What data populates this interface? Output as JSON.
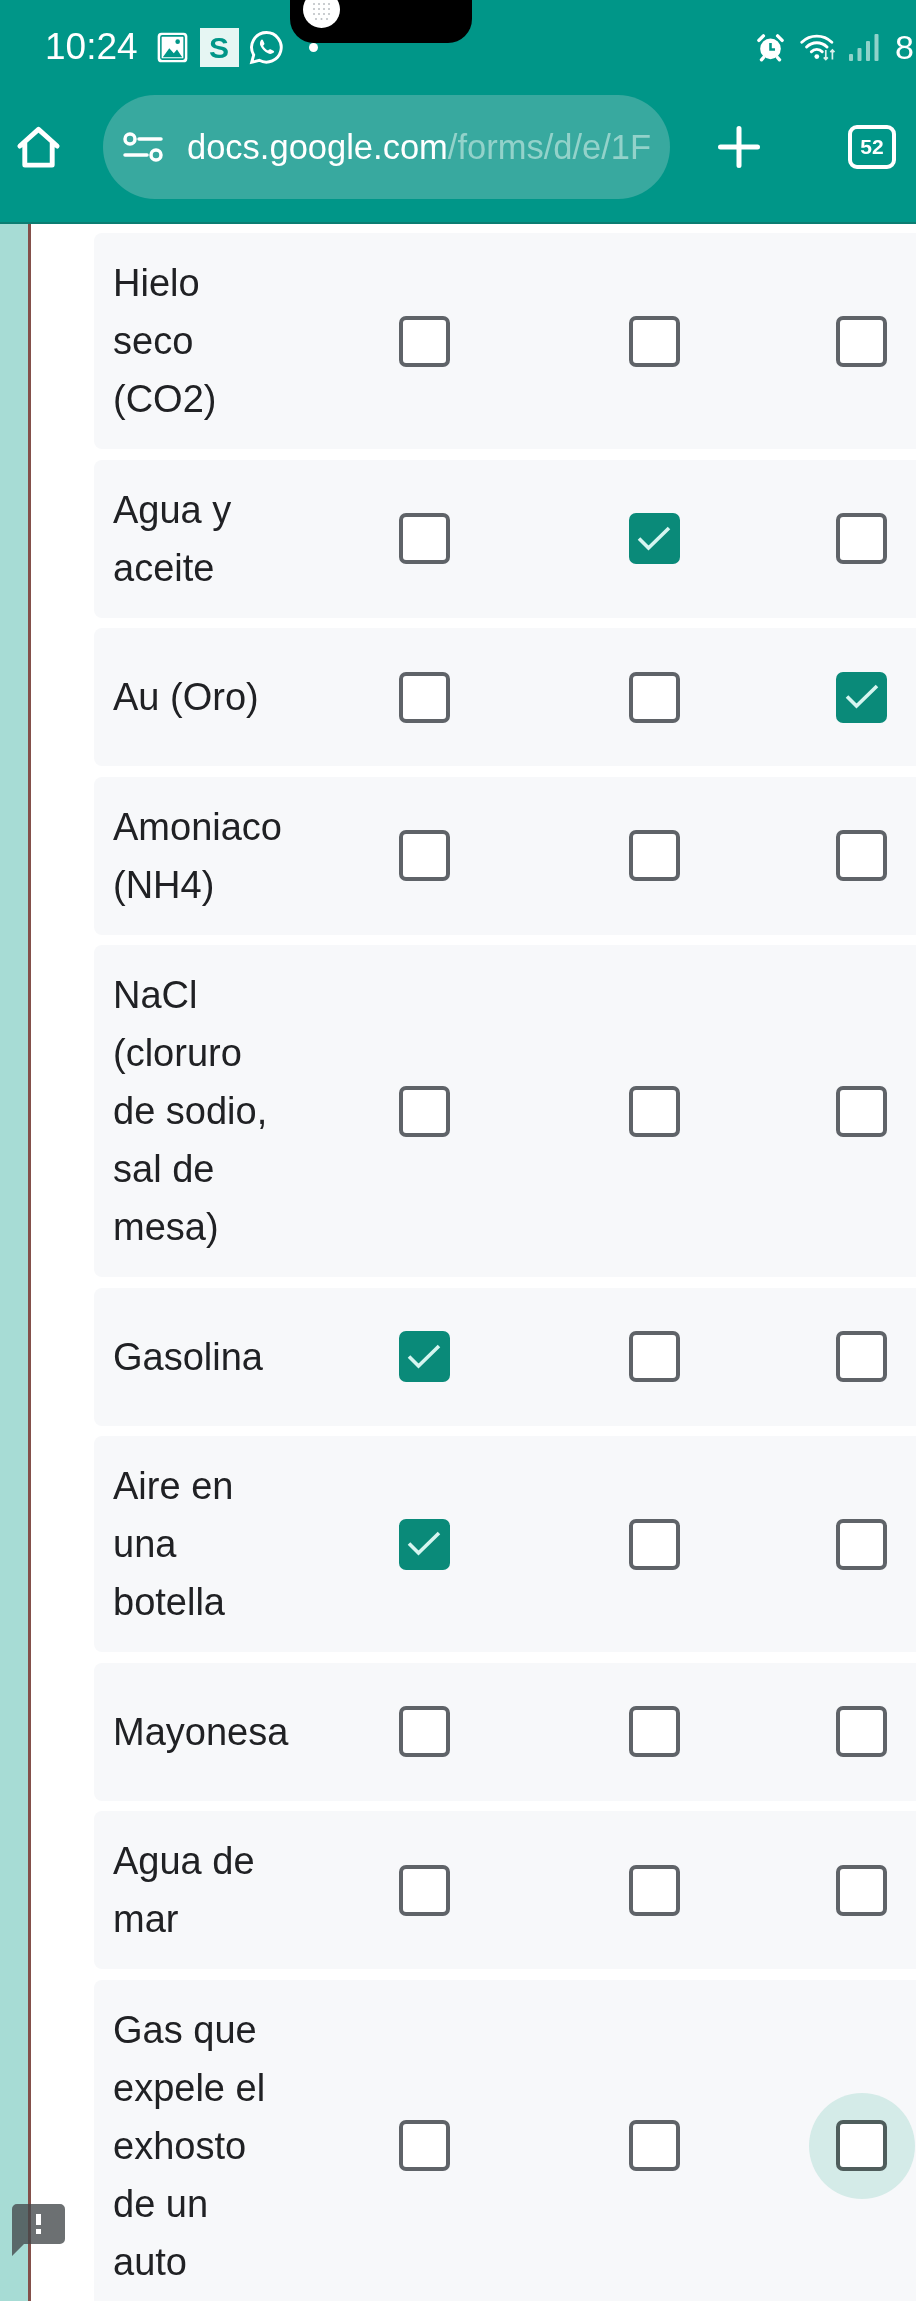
{
  "status_bar": {
    "time": "10:24",
    "app_badge": "S",
    "battery": "8"
  },
  "browser_toolbar": {
    "url_domain": "docs.google.com",
    "url_path": "/forms/d/e/1F",
    "tab_count": "52"
  },
  "grid": {
    "rows": [
      {
        "label": "Hielo seco (CO2)",
        "options": [
          {
            "checked": false,
            "focused": false
          },
          {
            "checked": false,
            "focused": false
          },
          {
            "checked": false,
            "focused": false
          }
        ]
      },
      {
        "label": "Agua y aceite",
        "options": [
          {
            "checked": false,
            "focused": false
          },
          {
            "checked": true,
            "focused": false
          },
          {
            "checked": false,
            "focused": false
          }
        ]
      },
      {
        "label": "Au (Oro)",
        "options": [
          {
            "checked": false,
            "focused": false
          },
          {
            "checked": false,
            "focused": false
          },
          {
            "checked": true,
            "focused": false
          }
        ]
      },
      {
        "label": "Amoniaco (NH4)",
        "options": [
          {
            "checked": false,
            "focused": false
          },
          {
            "checked": false,
            "focused": false
          },
          {
            "checked": false,
            "focused": false
          }
        ]
      },
      {
        "label": "NaCl (cloruro de sodio, sal de mesa)",
        "options": [
          {
            "checked": false,
            "focused": false
          },
          {
            "checked": false,
            "focused": false
          },
          {
            "checked": false,
            "focused": false
          }
        ]
      },
      {
        "label": "Gasolina",
        "options": [
          {
            "checked": true,
            "focused": false
          },
          {
            "checked": false,
            "focused": false
          },
          {
            "checked": false,
            "focused": false
          }
        ]
      },
      {
        "label": "Aire en una botella",
        "options": [
          {
            "checked": true,
            "focused": false
          },
          {
            "checked": false,
            "focused": false
          },
          {
            "checked": false,
            "focused": false
          }
        ]
      },
      {
        "label": "Mayonesa",
        "options": [
          {
            "checked": false,
            "focused": false
          },
          {
            "checked": false,
            "focused": false
          },
          {
            "checked": false,
            "focused": false
          }
        ]
      },
      {
        "label": "Agua de mar",
        "options": [
          {
            "checked": false,
            "focused": false
          },
          {
            "checked": false,
            "focused": false
          },
          {
            "checked": false,
            "focused": false
          }
        ]
      },
      {
        "label": "Gas que expele el exhosto de un auto",
        "options": [
          {
            "checked": false,
            "focused": false
          },
          {
            "checked": false,
            "focused": false
          },
          {
            "checked": false,
            "focused": true
          }
        ]
      }
    ]
  }
}
